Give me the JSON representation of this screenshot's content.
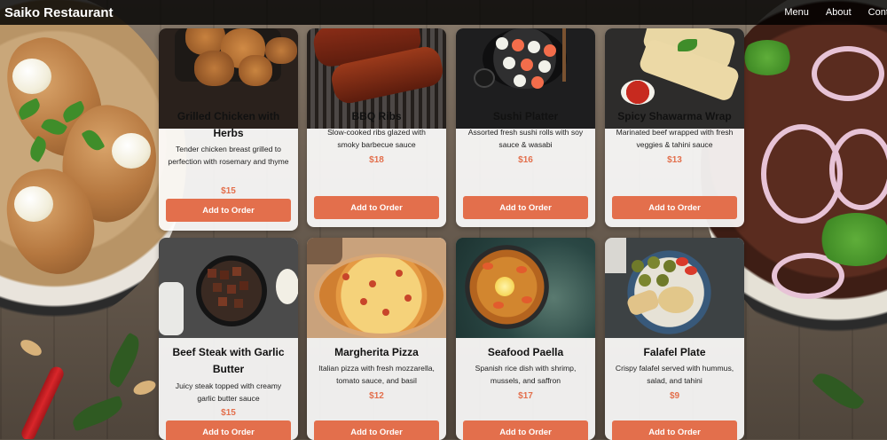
{
  "navbar": {
    "brand": "Saiko Restaurant",
    "links": [
      "Menu",
      "About",
      "Conta"
    ]
  },
  "menu": {
    "button_label": "Add to Order",
    "items": [
      {
        "name": "Grilled Chicken with Herbs",
        "description": "Tender chicken breast grilled to perfection with rosemary and thyme",
        "price": "$15",
        "photo_icon": "grilled-chicken-photo"
      },
      {
        "name": "BBQ Ribs",
        "description": "Slow-cooked ribs glazed with smoky barbecue sauce",
        "price": "$18",
        "photo_icon": "bbq-ribs-photo"
      },
      {
        "name": "Sushi Platter",
        "description": "Assorted fresh sushi rolls with soy sauce & wasabi",
        "price": "$16",
        "photo_icon": "sushi-platter-photo"
      },
      {
        "name": "Spicy Shawarma Wrap",
        "description": "Marinated beef wrapped with fresh veggies & tahini sauce",
        "price": "$13",
        "photo_icon": "shawarma-wrap-photo"
      },
      {
        "name": "Beef Steak with Garlic Butter",
        "description": "Juicy steak topped with creamy garlic butter sauce",
        "price": "$15",
        "photo_icon": "beef-steak-photo"
      },
      {
        "name": "Margherita Pizza",
        "description": "Italian pizza with fresh mozzarella, tomato sauce, and basil",
        "price": "$12",
        "photo_icon": "pizza-photo"
      },
      {
        "name": "Seafood Paella",
        "description": "Spanish rice dish with shrimp, mussels, and saffron",
        "price": "$17",
        "photo_icon": "paella-photo"
      },
      {
        "name": "Falafel Plate",
        "description": "Crispy falafel served with hummus, salad, and tahini",
        "price": "$9",
        "photo_icon": "falafel-photo"
      }
    ]
  },
  "colors": {
    "accent": "#e36f4c",
    "navbar_bg": "#000000"
  }
}
